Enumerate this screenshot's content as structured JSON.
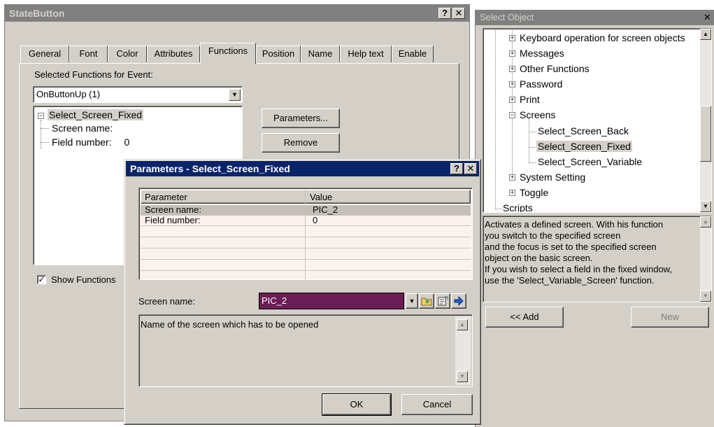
{
  "statebutton": {
    "title": "StateButton",
    "help_btn": "?",
    "close_btn": "✕",
    "tabs": [
      "General",
      "Font",
      "Color",
      "Attributes",
      "Functions",
      "Position",
      "Name",
      "Help text",
      "Enable"
    ],
    "selected_label": "Selected Functions for Event:",
    "event_value": "OnButtonUp  (1)",
    "tree_root": "Select_Screen_Fixed",
    "tree_child1": "Screen name:",
    "tree_child2": "Field number:",
    "tree_child2_value": "0",
    "parameters_btn": "Parameters...",
    "remove_btn": "Remove",
    "show_functions": "Show Functions"
  },
  "select_object": {
    "title": "Select Object",
    "close_btn": "✕",
    "items": [
      "Keyboard operation for screen objects",
      "Messages",
      "Other Functions",
      "Password",
      "Print",
      "Screens",
      "Select_Screen_Back",
      "Select_Screen_Fixed",
      "Select_Screen_Variable",
      "System Setting",
      "Toggle",
      "Scripts"
    ],
    "description": [
      "Activates a defined screen. With his function",
      "you switch to the specified screen",
      "and the focus is set to the specified screen",
      "object on the basic screen.",
      "If you wish to select a field in the fixed window,",
      "use the 'Select_Variable_Screen' function."
    ],
    "add_btn": "<< Add",
    "new_btn": "New"
  },
  "params": {
    "title": "Parameters - Select_Screen_Fixed",
    "help_btn": "?",
    "close_btn": "✕",
    "col_param": "Parameter",
    "col_value": "Value",
    "rows": [
      {
        "param": "Screen name:",
        "value": "PIC_2"
      },
      {
        "param": "Field number:",
        "value": "0"
      }
    ],
    "screen_label": "Screen name:",
    "screen_value": "PIC_2",
    "help_text": "Name of the screen which has to be opened",
    "ok_btn": "OK",
    "cancel_btn": "Cancel"
  },
  "colors": {
    "title_active": "#0a246a",
    "title_inactive": "#808080",
    "selection": "#6b1e56",
    "face": "#d4d0c8"
  }
}
